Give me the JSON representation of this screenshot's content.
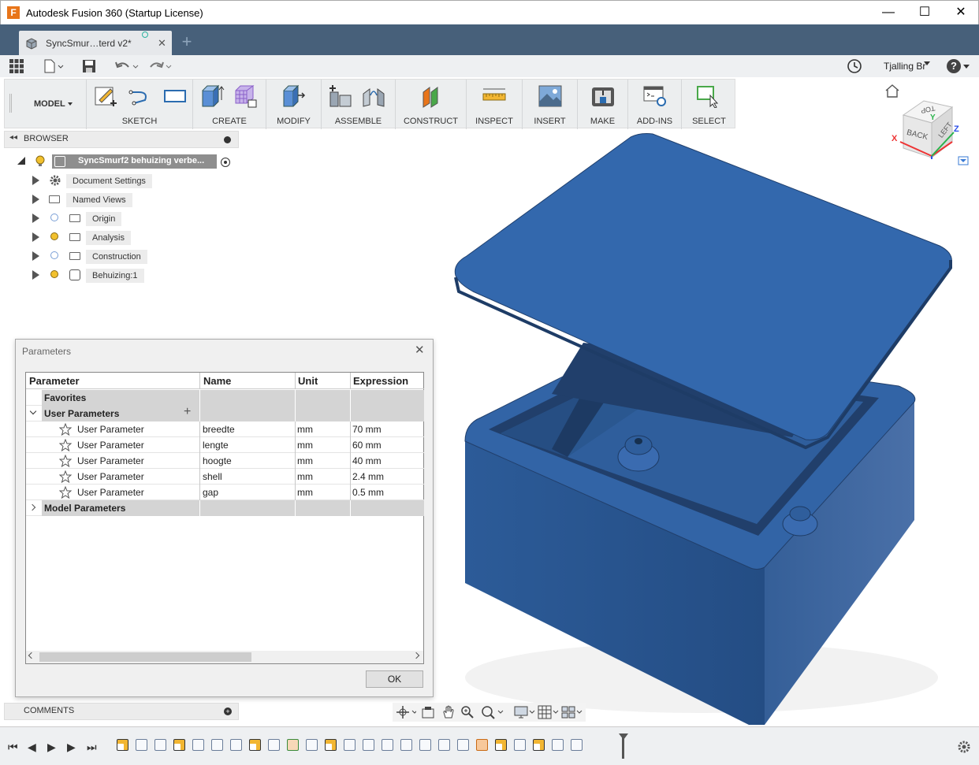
{
  "window": {
    "title": "Autodesk Fusion 360 (Startup License)",
    "app_icon": "F",
    "minimize": "—",
    "maximize": "☐",
    "close": "✕"
  },
  "tab": {
    "label": "SyncSmur…terd v2*",
    "close": "✕",
    "new": "+"
  },
  "quickbar": {
    "user": "Tjalling Br",
    "help": "?"
  },
  "ribbon": {
    "workspace": "MODEL",
    "groups": [
      "SKETCH",
      "CREATE",
      "MODIFY",
      "ASSEMBLE",
      "CONSTRUCT",
      "INSPECT",
      "INSERT",
      "MAKE",
      "ADD-INS",
      "SELECT"
    ]
  },
  "browser": {
    "title": "BROWSER",
    "root": "SyncSmurf2 behuizing verbe...",
    "items": [
      "Document Settings",
      "Named Views",
      "Origin",
      "Analysis",
      "Construction",
      "Behuizing:1"
    ]
  },
  "viewcube": {
    "back": "BACK",
    "left": "LEFT",
    "top": "TOP",
    "x": "X",
    "y": "Y",
    "z": "Z"
  },
  "parameters": {
    "title": "Parameters",
    "columns": [
      "Parameter",
      "Name",
      "Unit",
      "Expression"
    ],
    "favorites": "Favorites",
    "user_group": "User Parameters",
    "model_group": "Model Parameters",
    "rows": [
      {
        "param": "User Parameter",
        "name": "breedte",
        "unit": "mm",
        "expr": "70 mm"
      },
      {
        "param": "User Parameter",
        "name": "lengte",
        "unit": "mm",
        "expr": "60 mm"
      },
      {
        "param": "User Parameter",
        "name": "hoogte",
        "unit": "mm",
        "expr": "40 mm"
      },
      {
        "param": "User Parameter",
        "name": "shell",
        "unit": "mm",
        "expr": "2.4 mm"
      },
      {
        "param": "User Parameter",
        "name": "gap",
        "unit": "mm",
        "expr": "0.5 mm"
      }
    ],
    "ok": "OK"
  },
  "comments": {
    "title": "COMMENTS"
  },
  "colors": {
    "tabbar": "#47607a",
    "model_blue": "#2d5f9e",
    "accent_orange": "#e8751a"
  }
}
